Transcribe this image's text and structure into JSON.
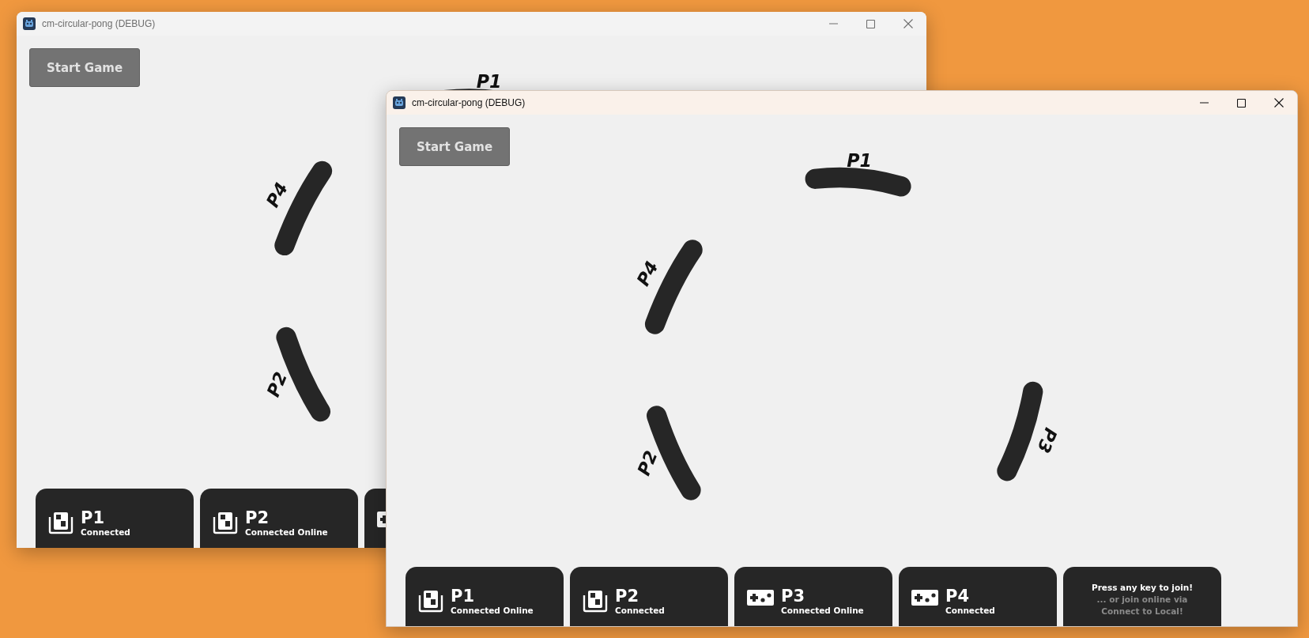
{
  "windows": [
    {
      "title": "cm-circular-pong (DEBUG)",
      "active": false,
      "start_button": "Start Game",
      "paddles": [
        {
          "kind": "top",
          "label": "P1"
        },
        {
          "kind": "upperleft",
          "label": "P4"
        },
        {
          "kind": "lowerleft",
          "label": "P2"
        }
      ],
      "cards": [
        {
          "kind": "keyboard",
          "name": "P1",
          "status": "Connected"
        },
        {
          "kind": "keyboard",
          "name": "P2",
          "status": "Connected Online"
        },
        {
          "kind": "gamepad"
        }
      ]
    },
    {
      "title": "cm-circular-pong (DEBUG)",
      "active": true,
      "start_button": "Start Game",
      "paddles": [
        {
          "kind": "top",
          "label": "P1"
        },
        {
          "kind": "upperleft",
          "label": "P4"
        },
        {
          "kind": "lowerleft",
          "label": "P2"
        },
        {
          "kind": "right",
          "label": "P3"
        }
      ],
      "cards": [
        {
          "kind": "keyboard",
          "name": "P1",
          "status": "Connected Online"
        },
        {
          "kind": "keyboard",
          "name": "P2",
          "status": "Connected"
        },
        {
          "kind": "gamepad",
          "name": "P3",
          "status": "Connected Online"
        },
        {
          "kind": "gamepad",
          "name": "P4",
          "status": "Connected"
        },
        {
          "kind": "join",
          "prompt": "Press any key to join!",
          "hints": [
            "... or join online via",
            "Connect to Local!"
          ]
        }
      ]
    }
  ]
}
